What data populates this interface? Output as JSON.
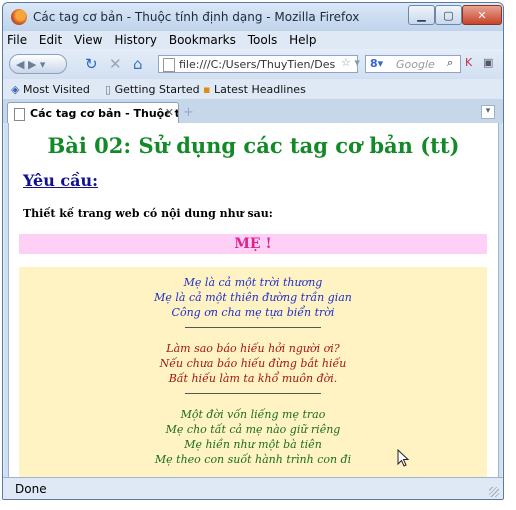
{
  "window": {
    "title": "Các tag cơ bản - Thuộc tính định dạng - Mozilla Firefox"
  },
  "menu": [
    "File",
    "Edit",
    "View",
    "History",
    "Bookmarks",
    "Tools",
    "Help"
  ],
  "url": "file:///C:/Users/ThuyTien/Des",
  "search_placeholder": "Google",
  "bookmarks": [
    "Most Visited",
    "Getting Started",
    "Latest Headlines"
  ],
  "tab": {
    "label": "Các tag cơ bản - Thuộc tính đ..."
  },
  "page": {
    "heading": "Bài 02: Sử dụng các tag cơ bản (tt)",
    "requirement": "Yêu cầu:",
    "description": "Thiết kế trang web có nội dung như sau:",
    "poem_title": "MẸ !",
    "stanzas": [
      {
        "color": "#1f2fc8",
        "lines": [
          "Mẹ là cả một trời thương",
          "Mẹ là cả một thiên đường trần gian",
          "Công ơn cha mẹ tựa biển trời"
        ]
      },
      {
        "color": "#a01818",
        "lines": [
          "Làm sao báo hiếu hởi người ơi?",
          "Nếu chưa báo hiếu đừng bắt hiếu",
          "Bất hiếu làm ta khổ muôn đời."
        ]
      },
      {
        "color": "#1c6e1c",
        "lines": [
          "Một đời vốn liếng mẹ trao",
          "Mẹ cho tất cả mẹ nào giữ riêng",
          "Mẹ hiền như một bà tiên",
          "Mẹ theo con suốt hành trình con đi"
        ]
      }
    ]
  },
  "status": "Done"
}
